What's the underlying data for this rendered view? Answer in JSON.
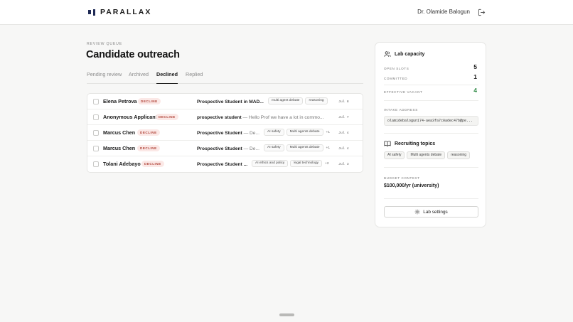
{
  "header": {
    "brand": "PARALLAX",
    "user_name": "Dr. Olamide Balogun",
    "logout_icon": "logout-icon"
  },
  "page": {
    "eyebrow": "REVIEW QUEUE",
    "title": "Candidate outreach"
  },
  "tabs": [
    {
      "label": "Pending review",
      "active": false
    },
    {
      "label": "Archived",
      "active": false
    },
    {
      "label": "Declined",
      "active": true
    },
    {
      "label": "Replied",
      "active": false
    }
  ],
  "rows": [
    {
      "name": "Elena Petrova",
      "badge": "DECLINE",
      "subject": "Prospective Student in MAD...",
      "snippet": "",
      "tags": [
        "multi agent debate",
        "reasoning"
      ],
      "more": "",
      "date": "Jul 8"
    },
    {
      "name": "Anonymous Applicant",
      "badge": "DECLINE",
      "subject": "prospective student",
      "snippet": "— Hello Prof we have a lot in commo...",
      "tags": [],
      "more": "",
      "date": "Jul 7"
    },
    {
      "name": "Marcus Chen",
      "badge": "DECLINE",
      "subject": "Prospective Student",
      "snippet": "— De...",
      "tags": [
        "AI safety",
        "Multi agents debate"
      ],
      "more": "+1",
      "date": "Jul 4"
    },
    {
      "name": "Marcus Chen",
      "badge": "DECLINE",
      "subject": "Prospective Student",
      "snippet": "— De...",
      "tags": [
        "AI safety",
        "Multi agents debate"
      ],
      "more": "+1",
      "date": "Jul 4"
    },
    {
      "name": "Tolani Adebayo",
      "badge": "DECLINE",
      "subject": "Prospective Student ...",
      "snippet": "",
      "tags": [
        "AI ethics and policy",
        "legal technology"
      ],
      "more": "+2",
      "date": "Jul 3"
    }
  ],
  "panel": {
    "capacity_title": "Lab capacity",
    "open_slots_label": "OPEN SLOTS",
    "open_slots": "5",
    "committed_label": "COMMITTED",
    "committed": "1",
    "vacant_label": "EFFECTIVE VACANT",
    "vacant": "4",
    "intake_label": "INTAKE ADDRESS",
    "intake_value": "olamidebalogun174-aea3fa7c0adec47b@pe...",
    "topics_title": "Recruiting topics",
    "topics": [
      "AI safety",
      "Multi agents debate",
      "reasoning"
    ],
    "budget_label": "BUDGET CONTEXT",
    "budget_value": "$100,000/yr (university)",
    "settings_label": "Lab settings"
  },
  "colors": {
    "decline_badge_bg": "#fbe8e6",
    "decline_badge_text": "#b0453a",
    "vacant_green": "#2f8a45",
    "brand_navy": "#1f2a55"
  }
}
